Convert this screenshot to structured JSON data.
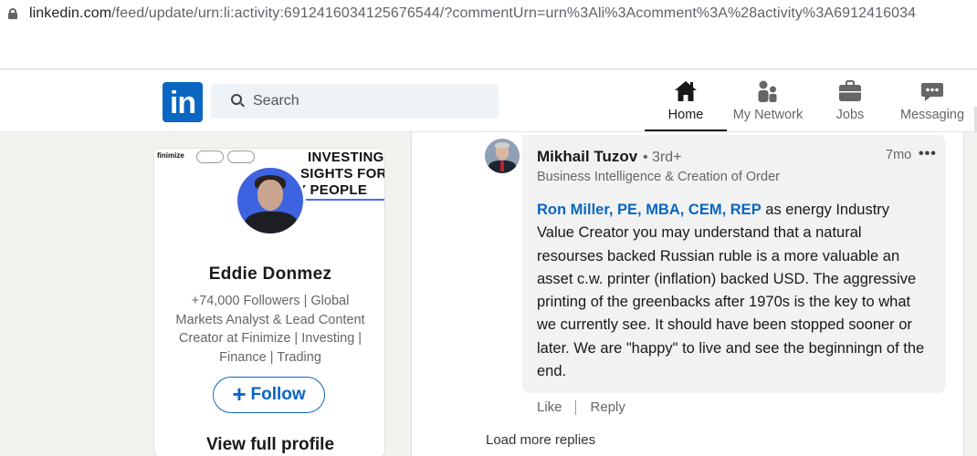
{
  "browser": {
    "url_main": "linkedin.com",
    "url_path": "/feed/update/urn:li:activity:6912416034125676544/?commentUrn=urn%3Ali%3Acomment%3A%28activity%3A6912416034"
  },
  "nav": {
    "logo": "in",
    "search_placeholder": "Search",
    "items": [
      {
        "label": "Home",
        "icon": "home-icon"
      },
      {
        "label": "My Network",
        "icon": "network-icon"
      },
      {
        "label": "Jobs",
        "icon": "briefcase-icon"
      },
      {
        "label": "Messaging",
        "icon": "message-icon"
      }
    ]
  },
  "profile_card": {
    "banner_brand": "finimize",
    "banner_text": [
      "INVESTING",
      "SIGHTS FOR",
      "Y PEOPLE"
    ],
    "name": "Eddie Donmez",
    "headline": "+74,000 Followers | Global Markets Analyst & Lead Content Creator at Finimize | Investing | Finance | Trading",
    "follow_label": "Follow",
    "view_profile_label": "View full profile"
  },
  "comment": {
    "author": "Mikhail Tuzov",
    "degree": "• 3rd+",
    "author_headline": "Business Intelligence & Creation of Order",
    "time": "7mo",
    "more_label": "•••",
    "mention": "Ron Miller, PE, MBA, CEM, REP",
    "text": " as energy Industry Value Creator you may understand that a natural resourses backed Russian ruble is a more valuable an asset c.w. printer (inflation) backed USD. The aggressive printing of the greenbacks after 1970s is the key to what we currently see. It should have been stopped sooner or later. We are \"happy\" to live and see the beginningn of the end.",
    "like_label": "Like",
    "reply_label": "Reply"
  },
  "load_more_label": "Load more replies",
  "colors": {
    "brand_blue": "#0a66c2",
    "bubble_bg": "#f2f2f2",
    "page_bg": "#f3f2ef"
  }
}
